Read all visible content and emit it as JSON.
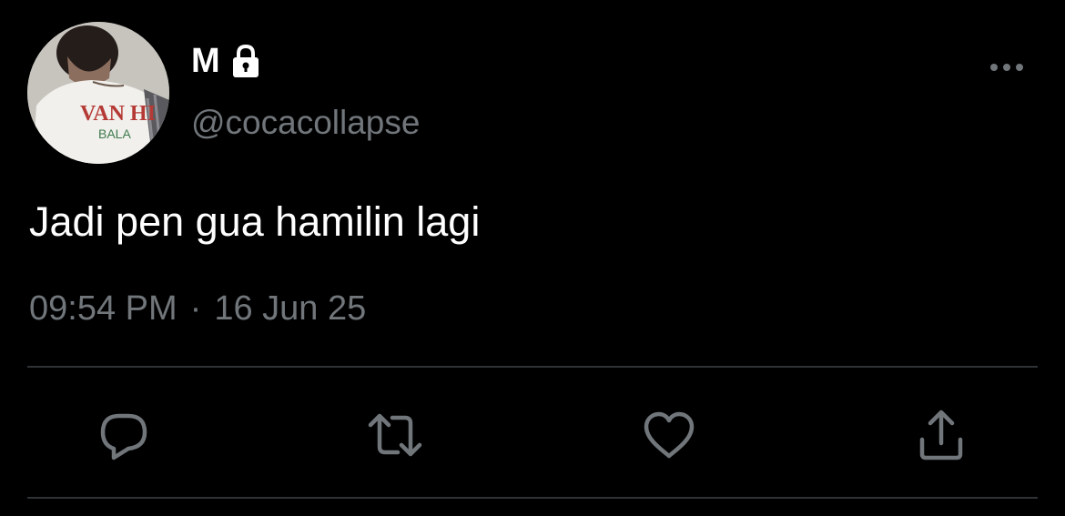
{
  "tweet": {
    "display_name": "M",
    "handle": "@cocacollapse",
    "text": "Jadi pen gua hamilin lagi",
    "time": "09:54 PM",
    "separator": "·",
    "date": "16 Jun 25",
    "protected_icon": "lock-icon",
    "more_icon": "more-horizontal-icon"
  },
  "avatar": {
    "shirt_text_top": "VAN HI",
    "shirt_text_bottom": "BALA"
  },
  "actions": [
    {
      "name": "reply",
      "icon": "reply-icon"
    },
    {
      "name": "retweet",
      "icon": "retweet-icon"
    },
    {
      "name": "like",
      "icon": "heart-icon"
    },
    {
      "name": "share",
      "icon": "share-icon"
    }
  ],
  "colors": {
    "background": "#000000",
    "primary_text": "#ffffff",
    "secondary_text": "#71767b",
    "divider": "#2f3336"
  }
}
